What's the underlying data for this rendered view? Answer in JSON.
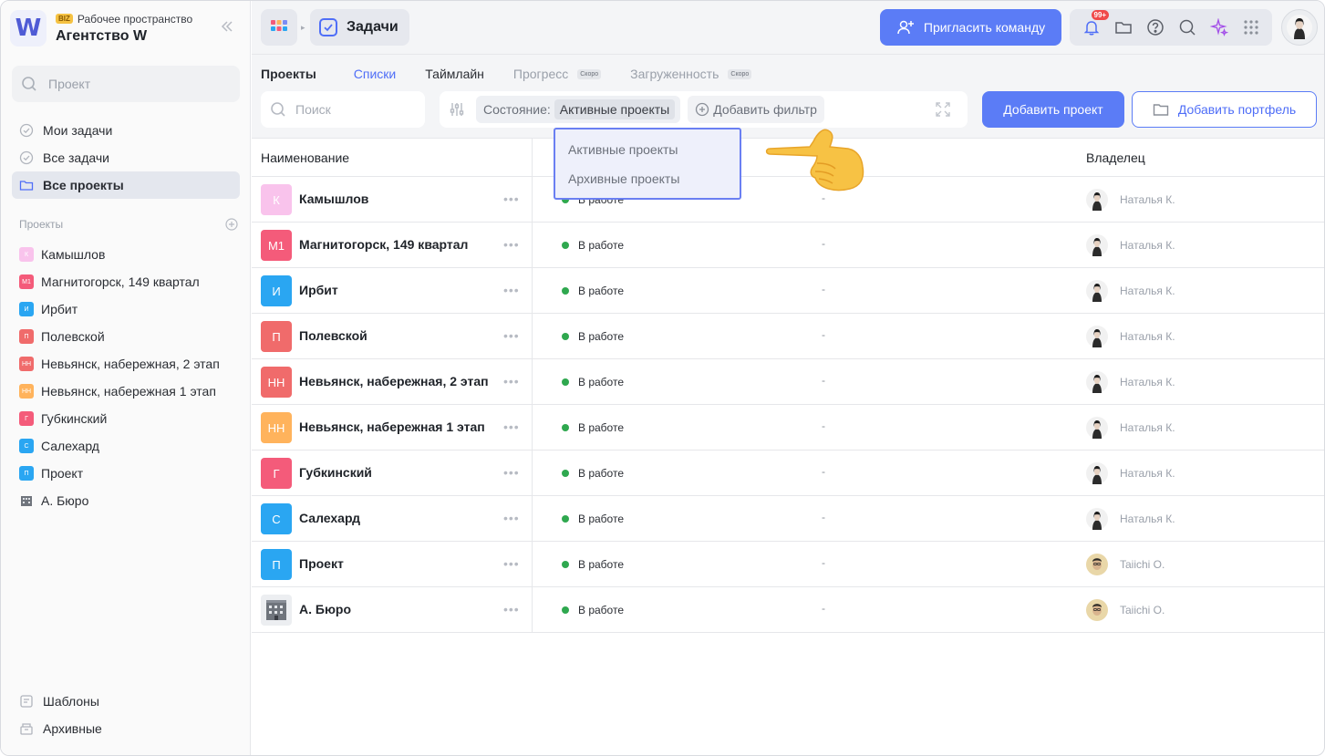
{
  "workspace": {
    "biz_badge": "BIZ",
    "subtitle": "Рабочее пространство",
    "name": "Агентство W",
    "logo_letter": "W"
  },
  "sidebar": {
    "search_placeholder": "Проект",
    "nav": [
      {
        "label": "Мои задачи",
        "icon": "check-circle-icon"
      },
      {
        "label": "Все задачи",
        "icon": "check-circle-icon"
      },
      {
        "label": "Все проекты",
        "icon": "folder-icon",
        "active": true
      }
    ],
    "projects_heading": "Проекты",
    "projects": [
      {
        "abbr": "К",
        "label": "Камышлов",
        "color": "#f9c3ec"
      },
      {
        "abbr": "М1",
        "label": "Магнитогорск, 149 квартал",
        "color": "#f45b7a"
      },
      {
        "abbr": "И",
        "label": "Ирбит",
        "color": "#2aa6f2"
      },
      {
        "abbr": "П",
        "label": "Полевской",
        "color": "#f06b6b"
      },
      {
        "abbr": "НН",
        "label": "Невьянск, набережная, 2 этап",
        "color": "#f06b6b"
      },
      {
        "abbr": "НН",
        "label": "Невьянск, набережная 1 этап",
        "color": "#ffb35c"
      },
      {
        "abbr": "Г",
        "label": "Губкинский",
        "color": "#f45b7a"
      },
      {
        "abbr": "С",
        "label": "Салехард",
        "color": "#2aa6f2"
      },
      {
        "abbr": "П",
        "label": "Проект",
        "color": "#2aa6f2"
      },
      {
        "abbr": "",
        "label": "А. Бюро",
        "color": "#7a7e86"
      }
    ],
    "bottom": [
      {
        "label": "Шаблоны",
        "icon": "templates-icon"
      },
      {
        "label": "Архивные",
        "icon": "archive-icon"
      }
    ]
  },
  "topbar": {
    "breadcrumb": "Задачи",
    "invite_label": "Пригласить команду",
    "notifications_count": "99+"
  },
  "tabs": [
    {
      "label": "Проекты"
    },
    {
      "label": "Списки"
    },
    {
      "label": "Таймлайн"
    },
    {
      "label": "Прогресс",
      "badge": "Скоро"
    },
    {
      "label": "Загруженность",
      "badge": "Скоро"
    }
  ],
  "toolbar": {
    "search_placeholder": "Поиск",
    "filter_label": "Состояние:",
    "filter_value": "Активные проекты",
    "add_filter": "Добавить фильтр",
    "add_project": "Добавить проект",
    "add_portfolio": "Добавить портфель"
  },
  "dropdown": {
    "options": [
      "Активные проекты",
      "Архивные проекты"
    ]
  },
  "table": {
    "col_name": "Наименование",
    "col_owner": "Владелец",
    "rows": [
      {
        "abbr": "К",
        "name": "Камышлов",
        "color": "#f9c3ec",
        "status": "В работе",
        "date": "-",
        "owner": "Наталья К."
      },
      {
        "abbr": "М1",
        "name": "Магнитогорск, 149 квартал",
        "color": "#f45b7a",
        "status": "В работе",
        "date": "-",
        "owner": "Наталья К."
      },
      {
        "abbr": "И",
        "name": "Ирбит",
        "color": "#2aa6f2",
        "status": "В работе",
        "date": "-",
        "owner": "Наталья К."
      },
      {
        "abbr": "П",
        "name": "Полевской",
        "color": "#f06b6b",
        "status": "В работе",
        "date": "-",
        "owner": "Наталья К."
      },
      {
        "abbr": "НН",
        "name": "Невьянск, набережная, 2 этап",
        "color": "#f06b6b",
        "status": "В работе",
        "date": "-",
        "owner": "Наталья К."
      },
      {
        "abbr": "НН",
        "name": "Невьянск, набережная 1 этап",
        "color": "#ffb35c",
        "status": "В работе",
        "date": "-",
        "owner": "Наталья К."
      },
      {
        "abbr": "Г",
        "name": "Губкинский",
        "color": "#f45b7a",
        "status": "В работе",
        "date": "-",
        "owner": "Наталья К."
      },
      {
        "abbr": "С",
        "name": "Салехард",
        "color": "#2aa6f2",
        "status": "В работе",
        "date": "-",
        "owner": "Наталья К."
      },
      {
        "abbr": "П",
        "name": "Проект",
        "color": "#2aa6f2",
        "status": "В работе",
        "date": "-",
        "owner": "Taiichi O."
      },
      {
        "abbr": "",
        "name": "А. Бюро",
        "color": "#eceef1",
        "status": "В работе",
        "date": "-",
        "owner": "Taiichi O."
      }
    ]
  }
}
